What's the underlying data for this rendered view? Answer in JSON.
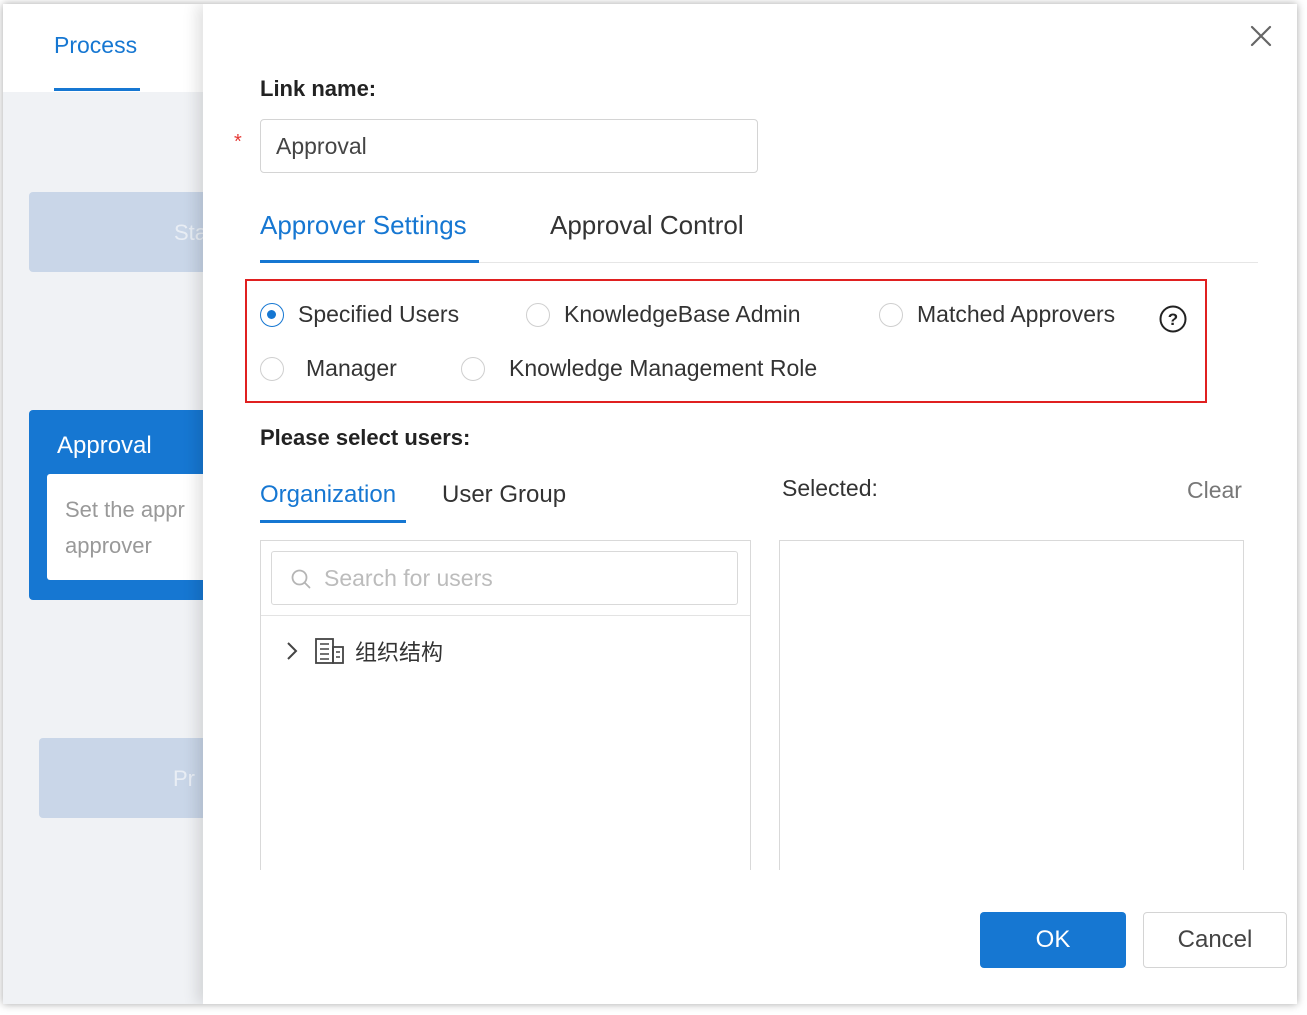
{
  "background": {
    "tab_label": "Process",
    "start_node_label": "Sta",
    "approval_node": {
      "title": "Approval",
      "body_line1": "Set the appr",
      "body_line2": "approver"
    },
    "process_node_label": "Pr"
  },
  "drawer": {
    "link_name_label": "Link name:",
    "required_mark": "*",
    "link_name_value": "Approval",
    "tabs": [
      {
        "label": "Approver Settings",
        "active": true
      },
      {
        "label": "Approval Control",
        "active": false
      }
    ],
    "approver_types": [
      {
        "label": "Specified Users",
        "checked": true
      },
      {
        "label": "KnowledgeBase Admin",
        "checked": false
      },
      {
        "label": "Matched Approvers",
        "checked": false
      },
      {
        "label": "Manager",
        "checked": false
      },
      {
        "label": "Knowledge Management Role",
        "checked": false
      }
    ],
    "help_icon": "question-circle-icon",
    "select_users_label": "Please select users:",
    "user_tabs": [
      {
        "label": "Organization",
        "active": true
      },
      {
        "label": "User Group",
        "active": false
      }
    ],
    "selected_label": "Selected:",
    "clear_label": "Clear",
    "search_placeholder": "Search for users",
    "tree_root_label": "组织结构",
    "ok_label": "OK",
    "cancel_label": "Cancel"
  },
  "colors": {
    "accent": "#1677d2",
    "highlight_border": "#e02020",
    "required": "#e53935"
  }
}
